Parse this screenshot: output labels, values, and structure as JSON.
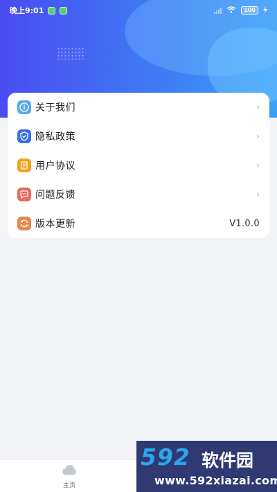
{
  "status_bar": {
    "time": "晚上9:01",
    "battery": "100"
  },
  "menu": {
    "items": [
      {
        "label": "关于我们",
        "icon": "info-icon",
        "color": "#5aa9ea",
        "trailing": "chevron"
      },
      {
        "label": "隐私政策",
        "icon": "shield-icon",
        "color": "#3b6fe0",
        "trailing": "chevron"
      },
      {
        "label": "用户协议",
        "icon": "document-icon",
        "color": "#f2a21d",
        "trailing": "chevron"
      },
      {
        "label": "问题反馈",
        "icon": "feedback-icon",
        "color": "#e66a5e",
        "trailing": "chevron"
      },
      {
        "label": "版本更新",
        "icon": "refresh-icon",
        "color": "#e8894f",
        "trailing": "value",
        "value": "V1.0.0"
      }
    ]
  },
  "tabbar": {
    "tabs": [
      {
        "label": "主页",
        "icon": "cloud-icon"
      }
    ]
  },
  "watermark": {
    "brand": "592",
    "site_cn": "软件园",
    "url": "www.592xiazai.com"
  },
  "colors": {
    "header_gradient_start": "#4a4cf2",
    "header_gradient_end": "#3aa0f6",
    "background": "#f3f4f8"
  }
}
